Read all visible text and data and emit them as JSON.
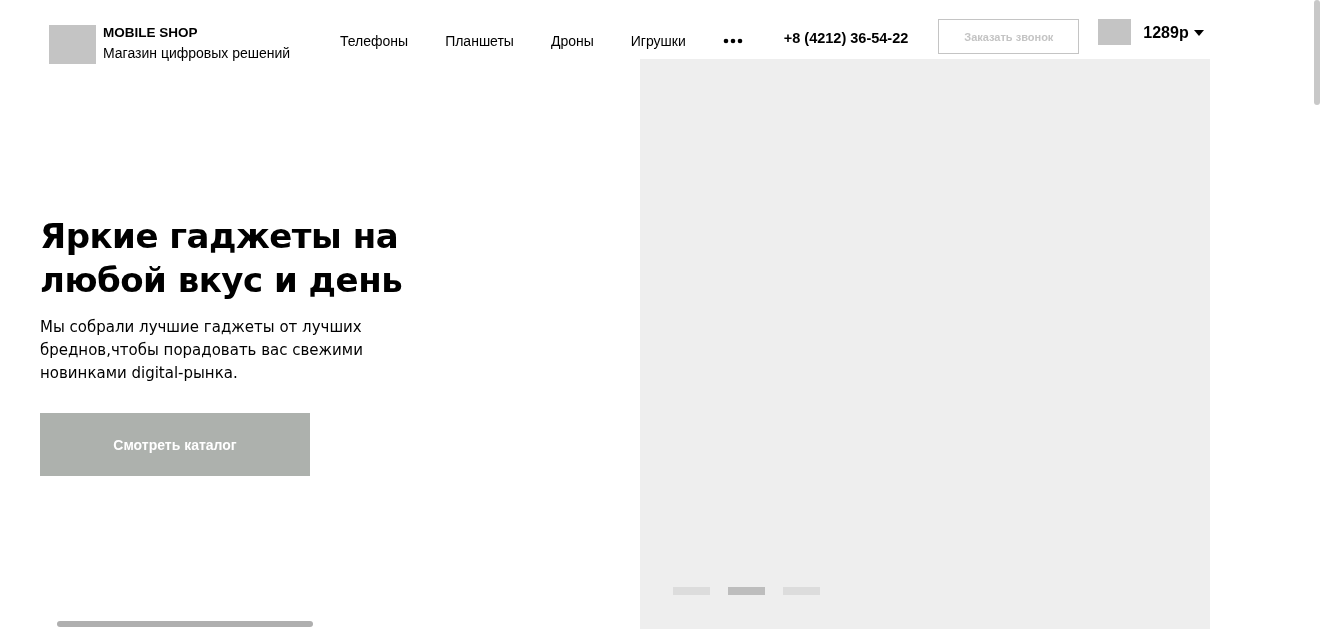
{
  "header": {
    "brand": "MOBILE SHOP",
    "tagline": "Магазин цифровых решений",
    "nav": [
      {
        "label": "Телефоны"
      },
      {
        "label": "Планшеты"
      },
      {
        "label": "Дроны"
      },
      {
        "label": "Игрушки"
      }
    ],
    "phone": "+8 (4212) 36-54-22",
    "callback_button": "Заказать звонок",
    "cart_total": "1289р"
  },
  "hero": {
    "title": "Яркие гаджеты на любой вкус и день",
    "text": "Мы собрали лучшие гаджеты от лучших бреднов,чтобы порадовать вас свежими новинками digital-рынка.",
    "button": "Смотреть каталог"
  },
  "slider": {
    "dots": [
      {
        "selected": false
      },
      {
        "selected": true
      },
      {
        "selected": false
      }
    ]
  }
}
